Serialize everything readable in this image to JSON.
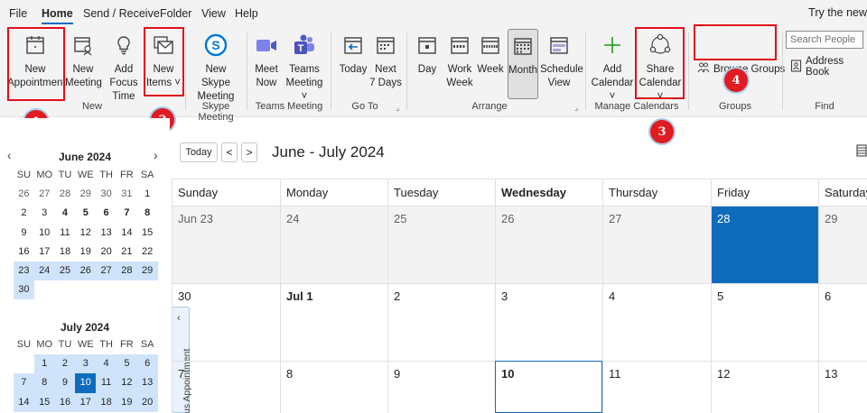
{
  "menubar": {
    "tabs": [
      "File",
      "Home",
      "Send / Receive",
      "Folder",
      "View",
      "Help"
    ],
    "try_new": "Try the new"
  },
  "ribbon": {
    "new_group": {
      "new_appointment": [
        "New",
        "Appointment"
      ],
      "new_meeting": [
        "New",
        "Meeting"
      ],
      "add_focus_time": [
        "Add Focus",
        "Time"
      ],
      "new_items": [
        "New",
        "Items ˅"
      ],
      "label": "New"
    },
    "skype_group": {
      "new_skype_meeting": [
        "New Skype",
        "Meeting"
      ],
      "label": "Skype Meeting"
    },
    "teams_group": {
      "meet_now": [
        "Meet",
        "Now"
      ],
      "teams_meeting": [
        "Teams",
        "Meeting ˅"
      ],
      "label": "Teams Meeting"
    },
    "goto_group": {
      "today": [
        "Today"
      ],
      "next_7_days": [
        "Next",
        "7 Days"
      ],
      "label": "Go To"
    },
    "arrange_group": {
      "day": [
        "Day"
      ],
      "work_week": [
        "Work",
        "Week"
      ],
      "week": [
        "Week"
      ],
      "month": [
        "Month"
      ],
      "schedule_view": [
        "Schedule",
        "View"
      ],
      "label": "Arrange"
    },
    "manage_group": {
      "add_calendar": [
        "Add",
        "Calendar ˅"
      ],
      "share_calendar": [
        "Share",
        "Calendar ˅"
      ],
      "label": "Manage Calendars"
    },
    "groups_group": {
      "browse_groups": "Browse Groups",
      "label": "Groups"
    },
    "find_group": {
      "search_placeholder": "Search People",
      "address_book": "Address Book",
      "label": "Find"
    }
  },
  "annotations": [
    "1",
    "2",
    "3",
    "4"
  ],
  "mini_calendars": [
    {
      "title": "June 2024",
      "headers": [
        "SU",
        "MO",
        "TU",
        "WE",
        "TH",
        "FR",
        "SA"
      ],
      "weeks": [
        [
          "26",
          "27",
          "28",
          "29",
          "30",
          "31",
          "1"
        ],
        [
          "2",
          "3",
          "4",
          "5",
          "6",
          "7",
          "8"
        ],
        [
          "9",
          "10",
          "11",
          "12",
          "13",
          "14",
          "15"
        ],
        [
          "16",
          "17",
          "18",
          "19",
          "20",
          "21",
          "22"
        ],
        [
          "23",
          "24",
          "25",
          "26",
          "27",
          "28",
          "29"
        ],
        [
          "30"
        ]
      ]
    },
    {
      "title": "July 2024",
      "headers": [
        "SU",
        "MO",
        "TU",
        "WE",
        "TH",
        "FR",
        "SA"
      ],
      "weeks": [
        [
          "",
          "1",
          "2",
          "3",
          "4",
          "5",
          "6"
        ],
        [
          "7",
          "8",
          "9",
          "10",
          "11",
          "12",
          "13"
        ],
        [
          "14",
          "15",
          "16",
          "17",
          "18",
          "19",
          "20"
        ]
      ]
    }
  ],
  "collapse_strip_text": "us Appointment",
  "calendar": {
    "today_button": "Today",
    "prev_arrow": "<",
    "next_arrow": ">",
    "title": "June - July 2024",
    "day_headers": [
      "Sunday",
      "Monday",
      "Tuesday",
      "Wednesday",
      "Thursday",
      "Friday",
      "Saturday"
    ],
    "weeks": [
      [
        "Jun 23",
        "24",
        "25",
        "26",
        "27",
        "28",
        "29"
      ],
      [
        "30",
        "Jul 1",
        "2",
        "3",
        "4",
        "5",
        "6"
      ],
      [
        "7",
        "8",
        "9",
        "10",
        "11",
        "12",
        "13"
      ]
    ]
  }
}
